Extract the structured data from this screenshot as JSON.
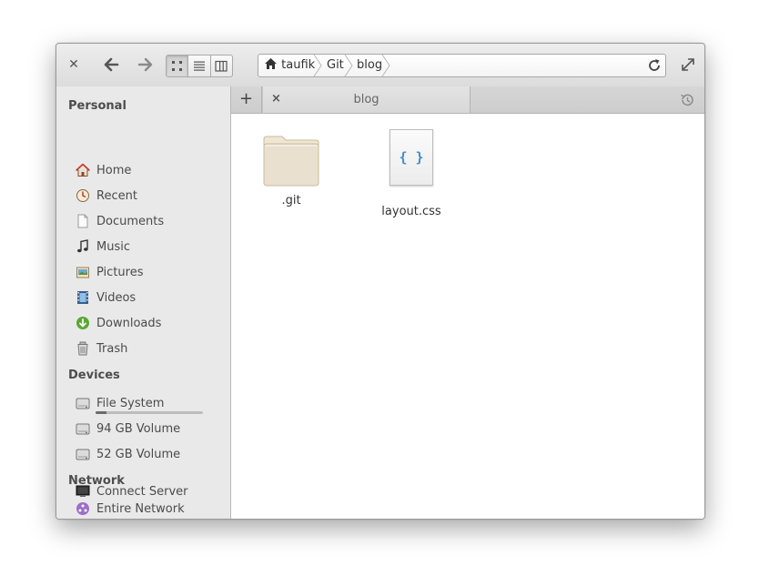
{
  "window": {
    "close_icon": "close-icon",
    "back_icon": "go-back-icon",
    "forward_icon": "go-forward-icon",
    "view_modes": [
      {
        "name": "icon-view",
        "active": true
      },
      {
        "name": "list-view",
        "active": false
      },
      {
        "name": "column-view",
        "active": false
      }
    ],
    "maximize_icon": "maximize-icon"
  },
  "pathbar": {
    "crumbs": [
      "taufik",
      "Git",
      "blog"
    ],
    "home_icon": "home-icon",
    "reload_icon": "reload-icon"
  },
  "sidebar": {
    "personal_header": "Personal",
    "personal": [
      {
        "label": "Home",
        "icon": "home-icon"
      },
      {
        "label": "Recent",
        "icon": "recent-icon"
      },
      {
        "label": "Documents",
        "icon": "documents-icon"
      },
      {
        "label": "Music",
        "icon": "music-icon"
      },
      {
        "label": "Pictures",
        "icon": "pictures-icon"
      },
      {
        "label": "Videos",
        "icon": "videos-icon"
      },
      {
        "label": "Downloads",
        "icon": "downloads-icon"
      },
      {
        "label": "Trash",
        "icon": "trash-icon"
      }
    ],
    "devices_header": "Devices",
    "devices": [
      {
        "label": "File System",
        "icon": "drive-icon",
        "usage_fraction": 0.1
      },
      {
        "label": "94 GB Volume",
        "icon": "drive-icon"
      },
      {
        "label": "52 GB Volume",
        "icon": "drive-icon"
      }
    ],
    "network_header": "Network",
    "network": [
      {
        "label": "Entire Network",
        "icon": "network-icon"
      },
      {
        "label": "Connect Server",
        "icon": "server-icon"
      }
    ]
  },
  "tabs": {
    "new_tab_label": "+",
    "items": [
      {
        "label": "blog",
        "close": "×"
      }
    ],
    "history_icon": "history-icon"
  },
  "files": [
    {
      "name": ".git",
      "type": "folder"
    },
    {
      "name": "layout.css",
      "type": "css",
      "glyph": "{ }"
    }
  ],
  "colors": {
    "css_glyph": "#3d8fd1",
    "folder": "#eae0cf"
  }
}
